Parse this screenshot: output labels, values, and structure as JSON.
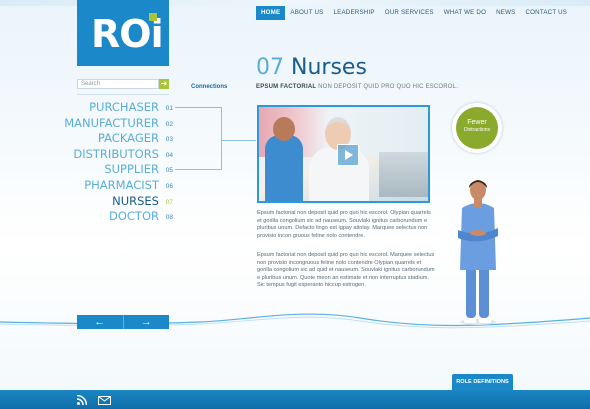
{
  "logo": {
    "text": "ROi"
  },
  "nav": [
    {
      "label": "HOME",
      "active": true
    },
    {
      "label": "ABOUT US"
    },
    {
      "label": "LEADERSHIP"
    },
    {
      "label": "OUR SERVICES"
    },
    {
      "label": "WHAT WE DO"
    },
    {
      "label": "NEWS"
    },
    {
      "label": "CONTACT US"
    }
  ],
  "search": {
    "placeholder": "Search",
    "button_icon": "arrow-right-icon"
  },
  "sidebar": {
    "connections_label": "Connections",
    "items": [
      {
        "label": "PURCHASER",
        "num": "01"
      },
      {
        "label": "MANUFACTURER",
        "num": "02"
      },
      {
        "label": "PACKAGER",
        "num": "03"
      },
      {
        "label": "DISTRIBUTORS",
        "num": "04"
      },
      {
        "label": "SUPPLIER",
        "num": "05"
      },
      {
        "label": "PHARMACIST",
        "num": "06"
      },
      {
        "label": "NURSES",
        "num": "07",
        "active": true
      },
      {
        "label": "DOCTOR",
        "num": "08"
      }
    ]
  },
  "main": {
    "title_num": "07",
    "title": "Nurses",
    "subtitle_bold": "EPSUM FACTORIAL",
    "subtitle_rest": " NON DEPOSIT QUID PRO QUO HIC ESCOROL.",
    "paragraph1": "Epsum factorial non deposit quid pro quo hic escorol. Olypian quarrels et gorilla congolium sic ad nauseum. Souvlaki ignitus carborundum e pluribus unum. Defacto lingo est igpay atinlay. Marquee selectus non provisio incon gruous feline nolo contendre.",
    "paragraph2": "Epsum factorial non deposit quid pro quo hic escorol. Marquee selectus non provisio incongruous feline nolo contendre Olypian quarrels et gorilla congolium sic ad quid et nauseum. Souvlaki ignitus carborundum e pluribus unum. Quote meon an estimate et non interruptus stadium. Sic tempus fugit esperanto hiccup estrogen."
  },
  "badge": {
    "line1": "Fewer",
    "line2": "Distractions"
  },
  "pager": {
    "prev_icon": "arrow-left-icon",
    "next_icon": "arrow-right-icon"
  },
  "role_tab": {
    "label": "ROLE DEFINITIONS"
  },
  "footer": {
    "icons": [
      "rss-icon",
      "mail-icon"
    ]
  },
  "colors": {
    "primary": "#1a88c9",
    "accent": "#a9c63a",
    "text_dark": "#1a5c8c",
    "text_light": "#5aaed6"
  }
}
